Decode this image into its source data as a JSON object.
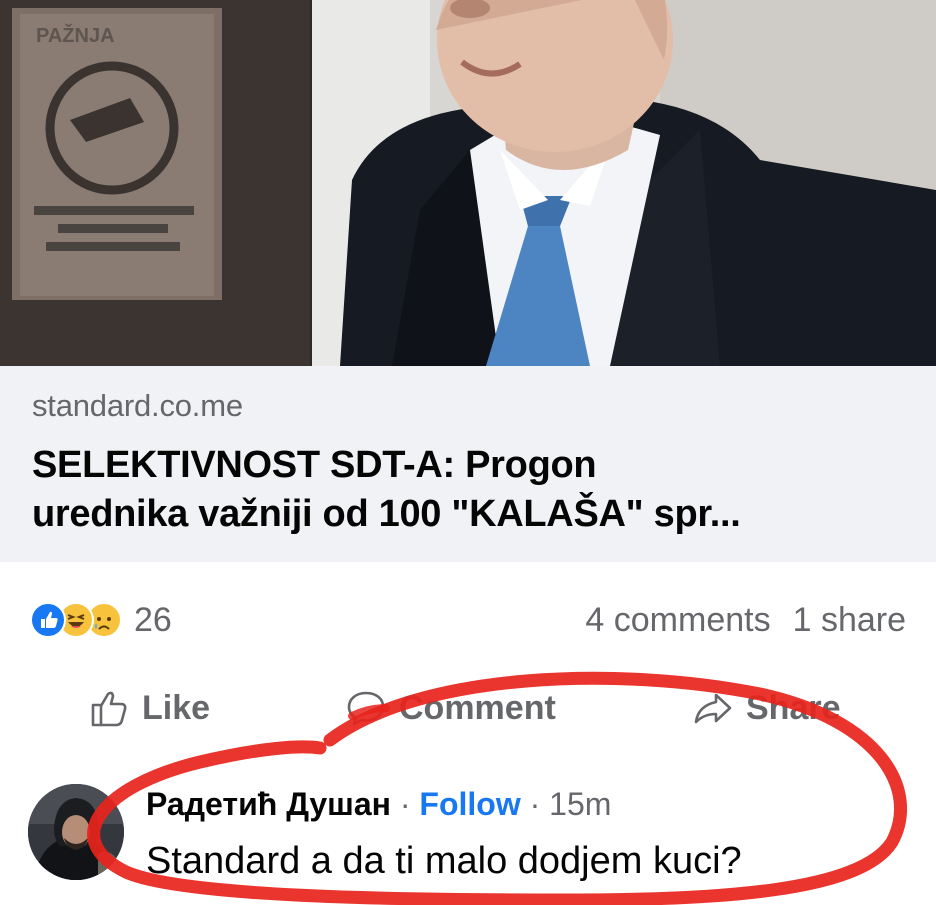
{
  "post": {
    "photo_sign_text": "PAŽNJA",
    "link": {
      "domain": "standard.co.me",
      "title_line1": "SELEKTIVNOST SDT-A: Progon",
      "title_line2": "urednika važniji od 100 \"KALAŠA\" spr..."
    },
    "reactions": {
      "types": [
        "like",
        "haha",
        "sad"
      ],
      "count": "26"
    },
    "stats": {
      "comments": "4 comments",
      "shares": "1 share"
    },
    "actions": {
      "like": "Like",
      "comment": "Comment",
      "share": "Share"
    }
  },
  "comment": {
    "author": "Радетић Душан",
    "separator": "·",
    "follow": "Follow",
    "time": "15m",
    "text": "Standard a da ti malo dodjem kuci?"
  },
  "colors": {
    "facebook_blue": "#1877f2",
    "meta_gray": "#65676b",
    "link_bg": "#f0f2f5",
    "marker_red": "#e8231c"
  }
}
